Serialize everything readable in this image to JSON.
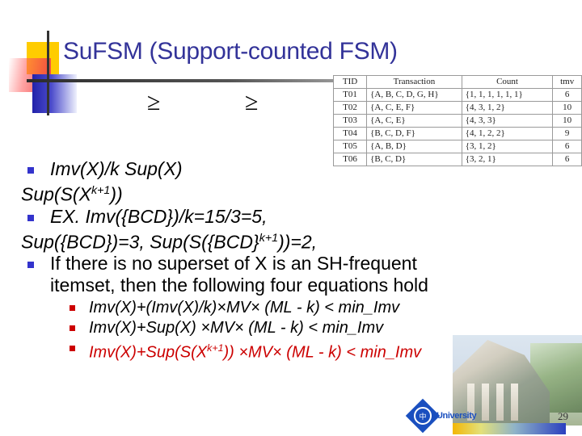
{
  "slide": {
    "title": "SuFSM (Support-counted FSM)",
    "page_number": "29"
  },
  "symbols": {
    "geq1": "≥",
    "geq2": "≥"
  },
  "table": {
    "headers": [
      "TID",
      "Transaction",
      "Count",
      "tmv"
    ],
    "rows": [
      {
        "tid": "T01",
        "transaction": "{A, B, C, D, G, H}",
        "count": "{1, 1, 1, 1, 1, 1}",
        "tmv": "6"
      },
      {
        "tid": "T02",
        "transaction": "{A, C, E, F}",
        "count": "{4, 3, 1, 2}",
        "tmv": "10"
      },
      {
        "tid": "T03",
        "transaction": "{A, C, E}",
        "count": "{4, 3, 3}",
        "tmv": "10"
      },
      {
        "tid": "T04",
        "transaction": "{B, C, D, F}",
        "count": "{4, 1, 2, 2}",
        "tmv": "9"
      },
      {
        "tid": "T05",
        "transaction": "{A, B, D}",
        "count": "{3, 1, 2}",
        "tmv": "6"
      },
      {
        "tid": "T06",
        "transaction": "{B, C, D}",
        "count": "{3, 2, 1}",
        "tmv": "6"
      }
    ]
  },
  "bullets": {
    "b1_line1": "Imv(X)/k        Sup(X)",
    "b1_line2": "Sup(S(X",
    "b1_line2_sup": "k+1",
    "b1_line2_tail": "))",
    "b2_line1": "EX. Imv({BCD})/k=15/3=5,",
    "b2_line2_a": "Sup({BCD})=3,  Sup(S({BCD}",
    "b2_line2_sup": "k+1",
    "b2_line2_tail": "))=2,",
    "b3_line1": "If there is no superset of X is an SH-frequent",
    "b3_line2": "itemset, then the following four equations hold",
    "sub1": "Imv(X)+(Imv(X)/k)×MV× (ML - k) < min_Imv",
    "sub2": "Imv(X)+Sup(X) ×MV× (ML - k) < min_Imv",
    "sub3_a": "Imv(X)+Sup(S(X",
    "sub3_sup": "k+1",
    "sub3_tail": ")) ×MV× (ML - k) < min_Imv"
  },
  "footer": {
    "logo_mark": "中",
    "logo_text": "University",
    "page": "29"
  },
  "colors": {
    "title": "#333399",
    "bullet_level1": "#3333CC",
    "bullet_level2": "#CC0000",
    "highlight_red": "#CC0000",
    "deco_yellow": "#FFCC00"
  }
}
